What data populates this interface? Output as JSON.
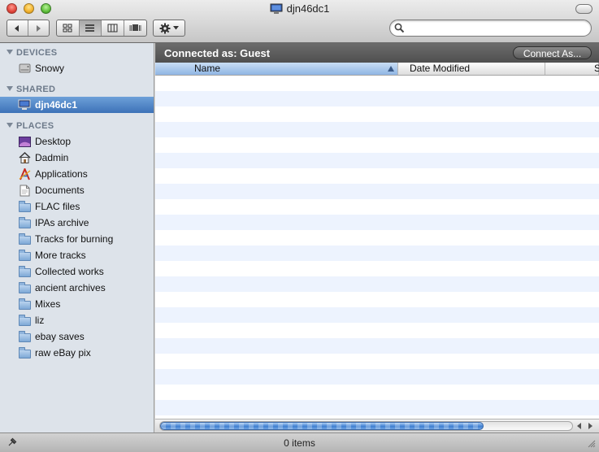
{
  "window": {
    "title": "djn46dc1"
  },
  "toolbar": {
    "back_icon": "back-arrow-icon",
    "forward_icon": "forward-arrow-icon",
    "view_modes": [
      "icon-view",
      "list-view",
      "column-view",
      "cover-flow-view"
    ],
    "selected_view": "list-view",
    "action_icon": "gear-icon",
    "search_value": "",
    "search_placeholder": ""
  },
  "sidebar": {
    "devices": {
      "header": "DEVICES",
      "items": [
        {
          "label": "Snowy",
          "icon": "hard-drive-icon"
        }
      ]
    },
    "shared": {
      "header": "SHARED",
      "items": [
        {
          "label": "djn46dc1",
          "icon": "network-computer-icon",
          "selected": true
        }
      ]
    },
    "places": {
      "header": "PLACES",
      "items": [
        {
          "label": "Desktop",
          "icon": "desktop-icon"
        },
        {
          "label": "Dadmin",
          "icon": "home-icon"
        },
        {
          "label": "Applications",
          "icon": "applications-icon"
        },
        {
          "label": "Documents",
          "icon": "documents-icon"
        },
        {
          "label": "FLAC files",
          "icon": "folder-icon"
        },
        {
          "label": "IPAs archive",
          "icon": "folder-icon"
        },
        {
          "label": "Tracks for burning",
          "icon": "folder-icon"
        },
        {
          "label": "More tracks",
          "icon": "folder-icon"
        },
        {
          "label": "Collected works",
          "icon": "folder-icon"
        },
        {
          "label": "ancient archives",
          "icon": "folder-icon"
        },
        {
          "label": "Mixes",
          "icon": "folder-icon"
        },
        {
          "label": "liz",
          "icon": "folder-icon"
        },
        {
          "label": "ebay saves",
          "icon": "folder-icon"
        },
        {
          "label": "raw eBay pix",
          "icon": "folder-icon"
        }
      ]
    }
  },
  "content": {
    "connected_text": "Connected as: Guest",
    "connect_button": "Connect As...",
    "columns": {
      "name": "Name",
      "date": "Date Modified",
      "size": "S"
    },
    "sort_column": "name"
  },
  "status": {
    "item_count": "0 items"
  },
  "colors": {
    "selection": "#3d72b8",
    "sidebar_bg": "#dde3ea",
    "row_alt": "#edf3fe",
    "path_bar": "#5a5a5a"
  }
}
